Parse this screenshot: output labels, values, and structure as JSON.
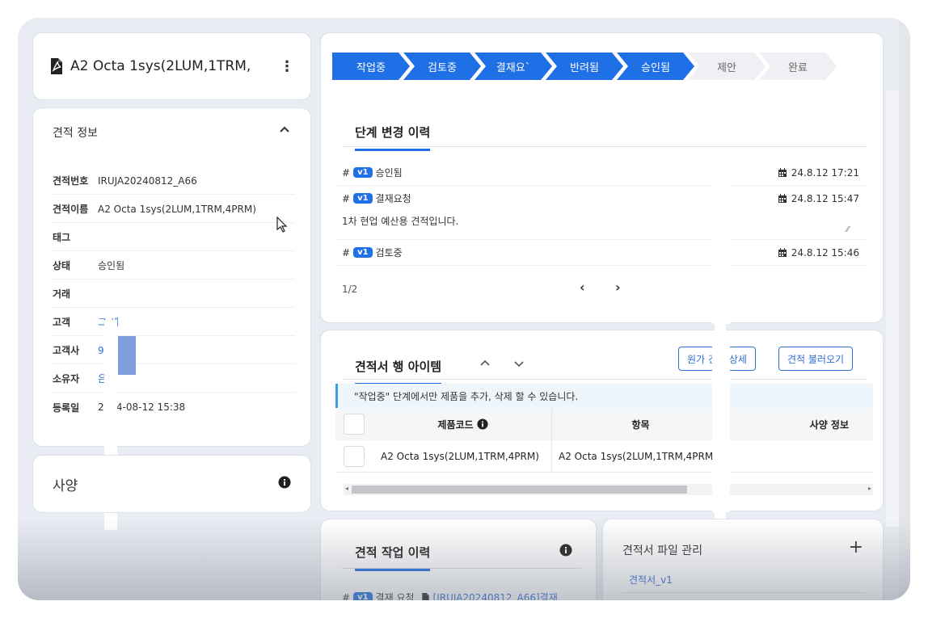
{
  "quote_title": "A2 Octa 1sys(2LUM,1TRM,",
  "info_card": {
    "header": "견적 정보",
    "rows": [
      {
        "key": "견적번호",
        "value": "IRUJA20240812_A66"
      },
      {
        "key": "견적이름",
        "value": "A2 Octa 1sys(2LUM,1TRM,4PRM)"
      },
      {
        "key": "태그",
        "value": ""
      },
      {
        "key": "상태",
        "value": "승인됨"
      },
      {
        "key": "거래",
        "value": ""
      },
      {
        "key": "고객",
        "value": "그 세"
      },
      {
        "key": "고객사",
        "value": "9"
      },
      {
        "key": "소유자",
        "value": "은"
      },
      {
        "key": "등록일",
        "value": "2024-08-12 15:38"
      }
    ]
  },
  "spec_card": {
    "label": "사양"
  },
  "stages": [
    {
      "label": "작업중",
      "active": true
    },
    {
      "label": "검토중",
      "active": true
    },
    {
      "label": "결재요`",
      "active": true
    },
    {
      "label": "반려됨",
      "active": true
    },
    {
      "label": "승인됨",
      "active": true
    },
    {
      "label": "제안",
      "active": false
    },
    {
      "label": "완료",
      "active": false
    }
  ],
  "stage_history": {
    "tab": "단계 변경 이력",
    "entries": [
      {
        "version": "v1",
        "status": "승인됨",
        "date": "24.8.12 17:21",
        "note": ""
      },
      {
        "version": "v1",
        "status": "결재요청",
        "date": "24.8.12 15:47",
        "note": "1차 현업 예산용 견적입니다."
      },
      {
        "version": "v1",
        "status": "검토중",
        "date": "24.8.12 15:46",
        "note": ""
      }
    ],
    "page": "1/2"
  },
  "line_items": {
    "tab": "견적서 행 아이템",
    "btn_cost": "원가 견적 상세",
    "btn_load": "견적 불러오기",
    "notice": "\"작업중\" 단계에서만 제품을 추가, 삭제 할 수 있습니다.",
    "columns": [
      "제품코드",
      "항목",
      "사양 정보"
    ],
    "rows": [
      {
        "code": "A2 Octa 1sys(2LUM,1TRM,4PRM)",
        "item": "A2 Octa 1sys(2LUM,1TRM,4PRM)",
        "spec": ""
      }
    ]
  },
  "work_history": {
    "tab": "견적 작업 이력",
    "entry_version": "v1",
    "entry_text": "결재 요청",
    "entry_link": "[IRUJA20240812_A66]결재"
  },
  "files": {
    "title": "견적서 파일 관리",
    "file": "견적서_v1"
  }
}
